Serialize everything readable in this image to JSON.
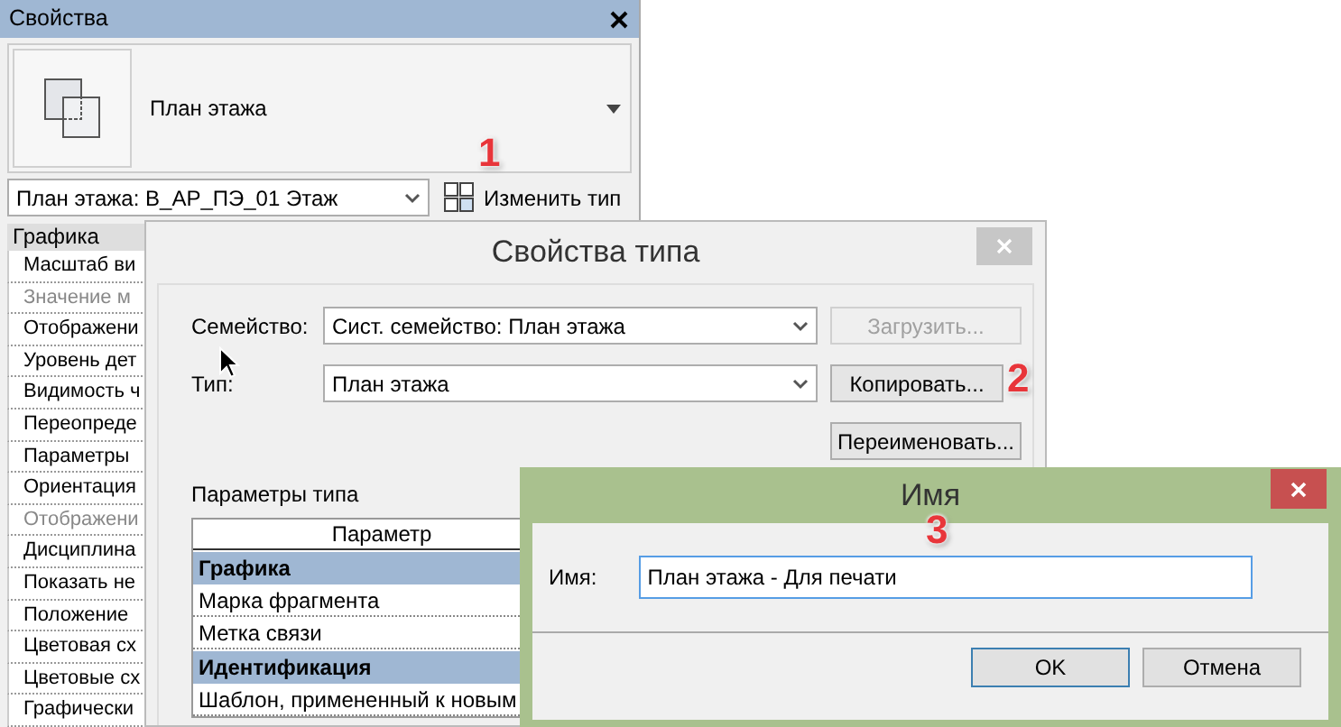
{
  "properties_panel": {
    "title": "Свойства",
    "type_name": "План этажа",
    "instance_selector": "План этажа: В_АР_ПЭ_01 Этаж",
    "edit_type_button": "Изменить тип",
    "section": "Графика",
    "rows": [
      {
        "label": "Масштаб ви",
        "disabled": false
      },
      {
        "label": "Значение м",
        "disabled": true
      },
      {
        "label": "Отображени",
        "disabled": false
      },
      {
        "label": "Уровень дет",
        "disabled": false
      },
      {
        "label": "Видимость ч",
        "disabled": false
      },
      {
        "label": "Переопреде",
        "disabled": false
      },
      {
        "label": "Параметры",
        "disabled": false
      },
      {
        "label": "Ориентация",
        "disabled": false
      },
      {
        "label": "Отображени",
        "disabled": true
      },
      {
        "label": "Дисциплина",
        "disabled": false
      },
      {
        "label": "Показать не",
        "disabled": false
      },
      {
        "label": "Положение",
        "disabled": false
      },
      {
        "label": "Цветовая сх",
        "disabled": false
      },
      {
        "label": "Цветовые сх",
        "disabled": false
      },
      {
        "label": "Графически",
        "disabled": false
      }
    ]
  },
  "type_properties_dialog": {
    "title": "Свойства типа",
    "fields": [
      {
        "label": "Семейство:",
        "value": "Сист. семейство: План этажа"
      },
      {
        "label": "Тип:",
        "value": "План этажа"
      }
    ],
    "buttons": [
      {
        "label": "Загрузить...",
        "disabled": true
      },
      {
        "label": "Копировать...",
        "disabled": false
      },
      {
        "label": "Переименовать...",
        "disabled": false
      }
    ],
    "params_label": "Параметры типа",
    "table": {
      "columns": [
        "Параметр"
      ],
      "rows": [
        {
          "kind": "group",
          "label": "Графика"
        },
        {
          "kind": "param",
          "label": "Марка фрагмента"
        },
        {
          "kind": "param",
          "label": "Метка связи"
        },
        {
          "kind": "group",
          "label": "Идентификация"
        },
        {
          "kind": "param",
          "label": "Шаблон, примененный к новым"
        }
      ]
    }
  },
  "name_dialog": {
    "title": "Имя",
    "label": "Имя:",
    "value": "План этажа - Для печати",
    "buttons": [
      {
        "label": "OK",
        "default": true
      },
      {
        "label": "Отмена",
        "default": false
      }
    ]
  },
  "annotations": [
    "1",
    "2",
    "3"
  ]
}
